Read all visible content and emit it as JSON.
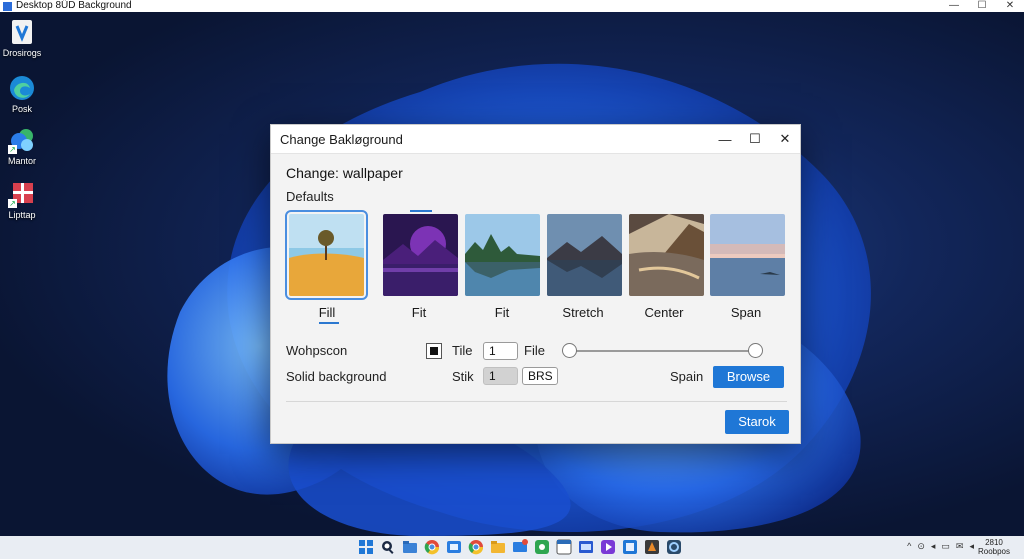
{
  "window": {
    "title": "Desktop 8ÜD Background",
    "minimize": "—",
    "maximize": "☐",
    "close": "✕"
  },
  "desktop_icons": [
    {
      "label": "Drosirogs",
      "icon": "drawing-app-icon"
    },
    {
      "label": "Posk",
      "icon": "edge-browser-icon"
    },
    {
      "label": "Mantor",
      "icon": "teams-app-icon"
    },
    {
      "label": "Lipttap",
      "icon": "flag-app-icon"
    }
  ],
  "dialog": {
    "title": "Change Bakløground",
    "minimize": "—",
    "maximize": "☐",
    "close": "✕",
    "heading": "Change: wallpaper",
    "section": "Defaults",
    "thumbnails": [
      {
        "caption": "Fill",
        "scene": "desert-tree",
        "selected": true
      },
      {
        "caption": "Fit",
        "scene": "purple-mountains"
      },
      {
        "caption": "Fit",
        "scene": "lake-forest"
      },
      {
        "caption": "Stretch",
        "scene": "mountain-lake"
      },
      {
        "caption": "Center",
        "scene": "sunset-valley"
      },
      {
        "caption": "Span",
        "scene": "calm-sea"
      }
    ],
    "row1": {
      "label": "Wohpscon",
      "checkbox_label": "Tile",
      "value": "1",
      "file_label": "File"
    },
    "row2": {
      "label": "Solid background",
      "stik_label": "Stik",
      "value": "1",
      "button_text": "BRS",
      "spain_label": "Spain",
      "browse": "Browse"
    },
    "primary_button": "Starok"
  },
  "taskbar": {
    "clock_time": "2810",
    "clock_date": "Roobpos",
    "tray": [
      "^",
      "⊙",
      "◂",
      "▭",
      "✉",
      "◂"
    ]
  }
}
